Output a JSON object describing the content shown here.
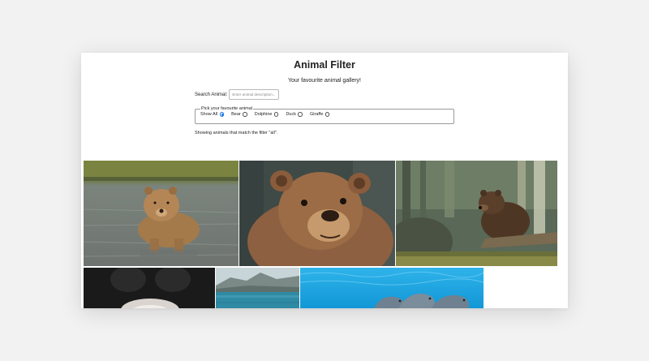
{
  "header": {
    "title": "Animal Filter",
    "subtitle": "Your favourite animal gallery!"
  },
  "search": {
    "label": "Search Animal:",
    "placeholder": "Enter animal description..."
  },
  "filter": {
    "legend": "Pick your favourite animal",
    "options": [
      {
        "label": "Show All",
        "checked": true
      },
      {
        "label": "Bear",
        "checked": false
      },
      {
        "label": "Dolphine",
        "checked": false
      },
      {
        "label": "Duck",
        "checked": false
      },
      {
        "label": "Giraffe",
        "checked": false
      }
    ]
  },
  "status_text": "Showing animals that match the filter \"all\".",
  "gallery": [
    {
      "subject": "bear-in-river"
    },
    {
      "subject": "bear-portrait"
    },
    {
      "subject": "bear-in-forest"
    },
    {
      "subject": "black-animal"
    },
    {
      "subject": "sea-with-mountains"
    },
    {
      "subject": "dolphins-in-pool"
    }
  ],
  "colors": {
    "accent": "#1a73e8",
    "background": "#f2f2f3",
    "panel": "#ffffff"
  }
}
